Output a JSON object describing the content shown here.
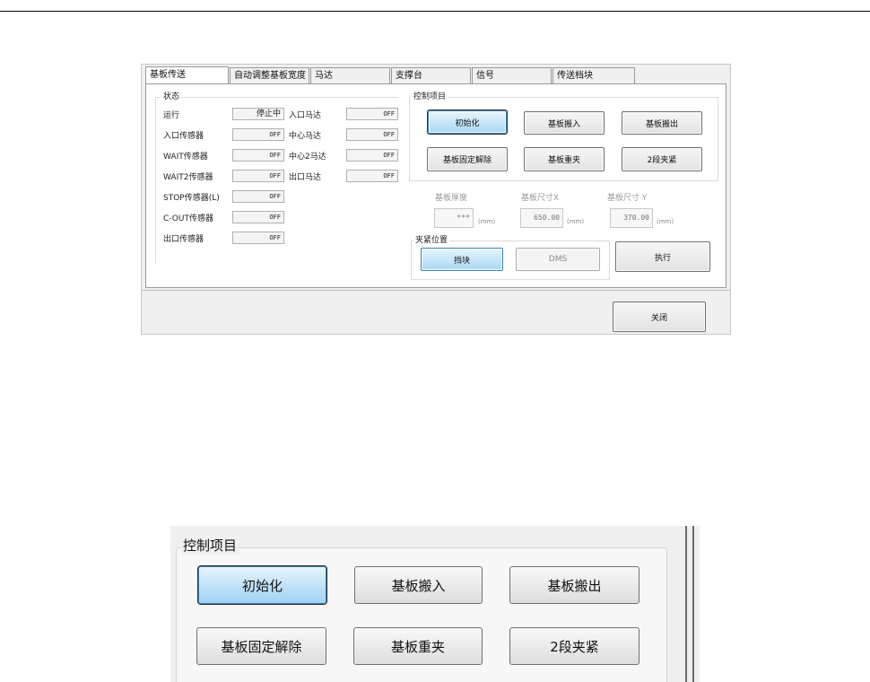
{
  "tabs": [
    {
      "label": "基板传送"
    },
    {
      "label": "自动调整基板宽度"
    },
    {
      "label": "马达"
    },
    {
      "label": "支撑台"
    },
    {
      "label": "信号"
    },
    {
      "label": "传送档块"
    }
  ],
  "status": {
    "title": "状态",
    "rows": [
      {
        "label": "运行",
        "value": "停止中"
      },
      {
        "label": "入口传感器",
        "value": "OFF"
      },
      {
        "label": "WAIT传感器",
        "value": "OFF"
      },
      {
        "label": "WAIT2传感器",
        "value": "OFF"
      },
      {
        "label": "STOP传感器(L)",
        "value": "OFF"
      },
      {
        "label": "C-OUT传感器",
        "value": "OFF"
      },
      {
        "label": "出口传感器",
        "value": "OFF"
      }
    ],
    "motors": [
      {
        "label": "入口马达",
        "value": "OFF"
      },
      {
        "label": "中心马达",
        "value": "OFF"
      },
      {
        "label": "中心2马达",
        "value": "OFF"
      },
      {
        "label": "出口马达",
        "value": "OFF"
      }
    ]
  },
  "control": {
    "title": "控制项目",
    "buttons": [
      {
        "label": "初始化"
      },
      {
        "label": "基板搬入"
      },
      {
        "label": "基板搬出"
      },
      {
        "label": "基板固定解除"
      },
      {
        "label": "基板重夹"
      },
      {
        "label": "2段夹紧"
      }
    ]
  },
  "params": {
    "thickness": {
      "label": "基板厚度",
      "value": "***",
      "unit": "(mm)"
    },
    "size_x": {
      "label": "基板尺寸X",
      "value": "650.00",
      "unit": "(mm)"
    },
    "size_y": {
      "label": "基板尺寸 Y",
      "value": "370.00",
      "unit": "(mm)"
    }
  },
  "clamp": {
    "title": "夹紧位置",
    "options": [
      {
        "label": "挡块"
      },
      {
        "label": "DMS"
      }
    ]
  },
  "execute_label": "执行",
  "close_label": "关闭",
  "zoom": {
    "title": "控制项目",
    "buttons": [
      {
        "label": "初始化"
      },
      {
        "label": "基板搬入"
      },
      {
        "label": "基板搬出"
      },
      {
        "label": "基板固定解除"
      },
      {
        "label": "基板重夹"
      },
      {
        "label": "2段夹紧"
      }
    ]
  }
}
